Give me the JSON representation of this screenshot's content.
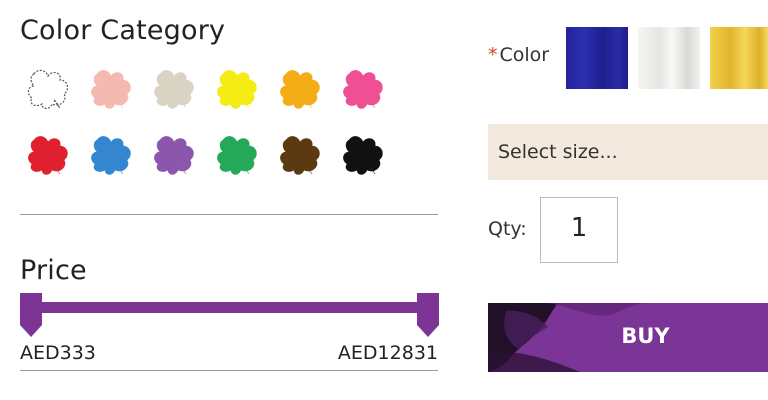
{
  "filters": {
    "color_category": {
      "title": "Color Category",
      "swatches": [
        {
          "name": "white",
          "color": "#ffffff"
        },
        {
          "name": "pink",
          "color": "#f4b9b0"
        },
        {
          "name": "cream",
          "color": "#d9d3c3"
        },
        {
          "name": "yellow",
          "color": "#f4ec12"
        },
        {
          "name": "orange",
          "color": "#f5ad17"
        },
        {
          "name": "hot-pink",
          "color": "#ef4f93"
        },
        {
          "name": "red",
          "color": "#e0202e"
        },
        {
          "name": "blue",
          "color": "#3386cf"
        },
        {
          "name": "purple",
          "color": "#8c56ac"
        },
        {
          "name": "green",
          "color": "#24a95a"
        },
        {
          "name": "brown",
          "color": "#5b3a12"
        },
        {
          "name": "black",
          "color": "#111111"
        }
      ]
    },
    "price": {
      "title": "Price",
      "min_label": "AED333",
      "max_label": "AED12831",
      "range_color": "#7c3594"
    }
  },
  "product_options": {
    "color": {
      "required_marker": "*",
      "label": "Color",
      "options": [
        {
          "name": "royal-blue",
          "color": "#23229a"
        },
        {
          "name": "white",
          "color": "#eeeeea"
        },
        {
          "name": "gold",
          "color": "#e6bb32"
        }
      ]
    },
    "size_select": {
      "placeholder": "Select size..."
    },
    "quantity": {
      "label": "Qty:",
      "value": "1"
    },
    "buy_button": {
      "label": "BUY",
      "color": "#7b3596"
    }
  }
}
